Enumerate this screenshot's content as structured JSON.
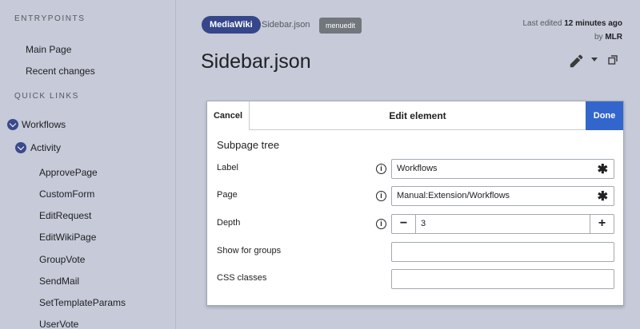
{
  "sidebar": {
    "entrypoints_heading": "ENTRYPOINTS",
    "entrypoints": [
      "Main Page",
      "Recent changes"
    ],
    "quicklinks_heading": "QUICK LINKS",
    "tree": {
      "root": "Workflows",
      "child": "Activity",
      "leaves": [
        "ApprovePage",
        "CustomForm",
        "EditRequest",
        "EditWikiPage",
        "GroupVote",
        "SendMail",
        "SetTemplateParams",
        "UserVote"
      ]
    }
  },
  "header": {
    "namespace_badge": "MediaWiki",
    "breadcrumb": "Sidebar.json",
    "content_model_badge": "menuedit",
    "last_edited_prefix": "Last edited",
    "last_edited_time": "12 minutes ago",
    "by_prefix": "by",
    "last_edited_by": "MLR",
    "title": "Sidebar.json"
  },
  "dialog": {
    "cancel_label": "Cancel",
    "title": "Edit element",
    "done_label": "Done",
    "subtitle": "Subpage tree",
    "fields": {
      "label": {
        "label": "Label",
        "value": "Workflows",
        "required_mark": "✱"
      },
      "page": {
        "label": "Page",
        "value": "Manual:Extension/Workflows",
        "required_mark": "✱"
      },
      "depth": {
        "label": "Depth",
        "value": "3",
        "minus": "−",
        "plus": "+"
      },
      "groups": {
        "label": "Show for groups",
        "value": ""
      },
      "css": {
        "label": "CSS classes",
        "value": ""
      }
    },
    "info_glyph": "i"
  },
  "colors": {
    "background": "#c6cad9",
    "accent": "#3366cc",
    "badge": "#36468a",
    "tree_toggle": "#3a4a8c"
  }
}
